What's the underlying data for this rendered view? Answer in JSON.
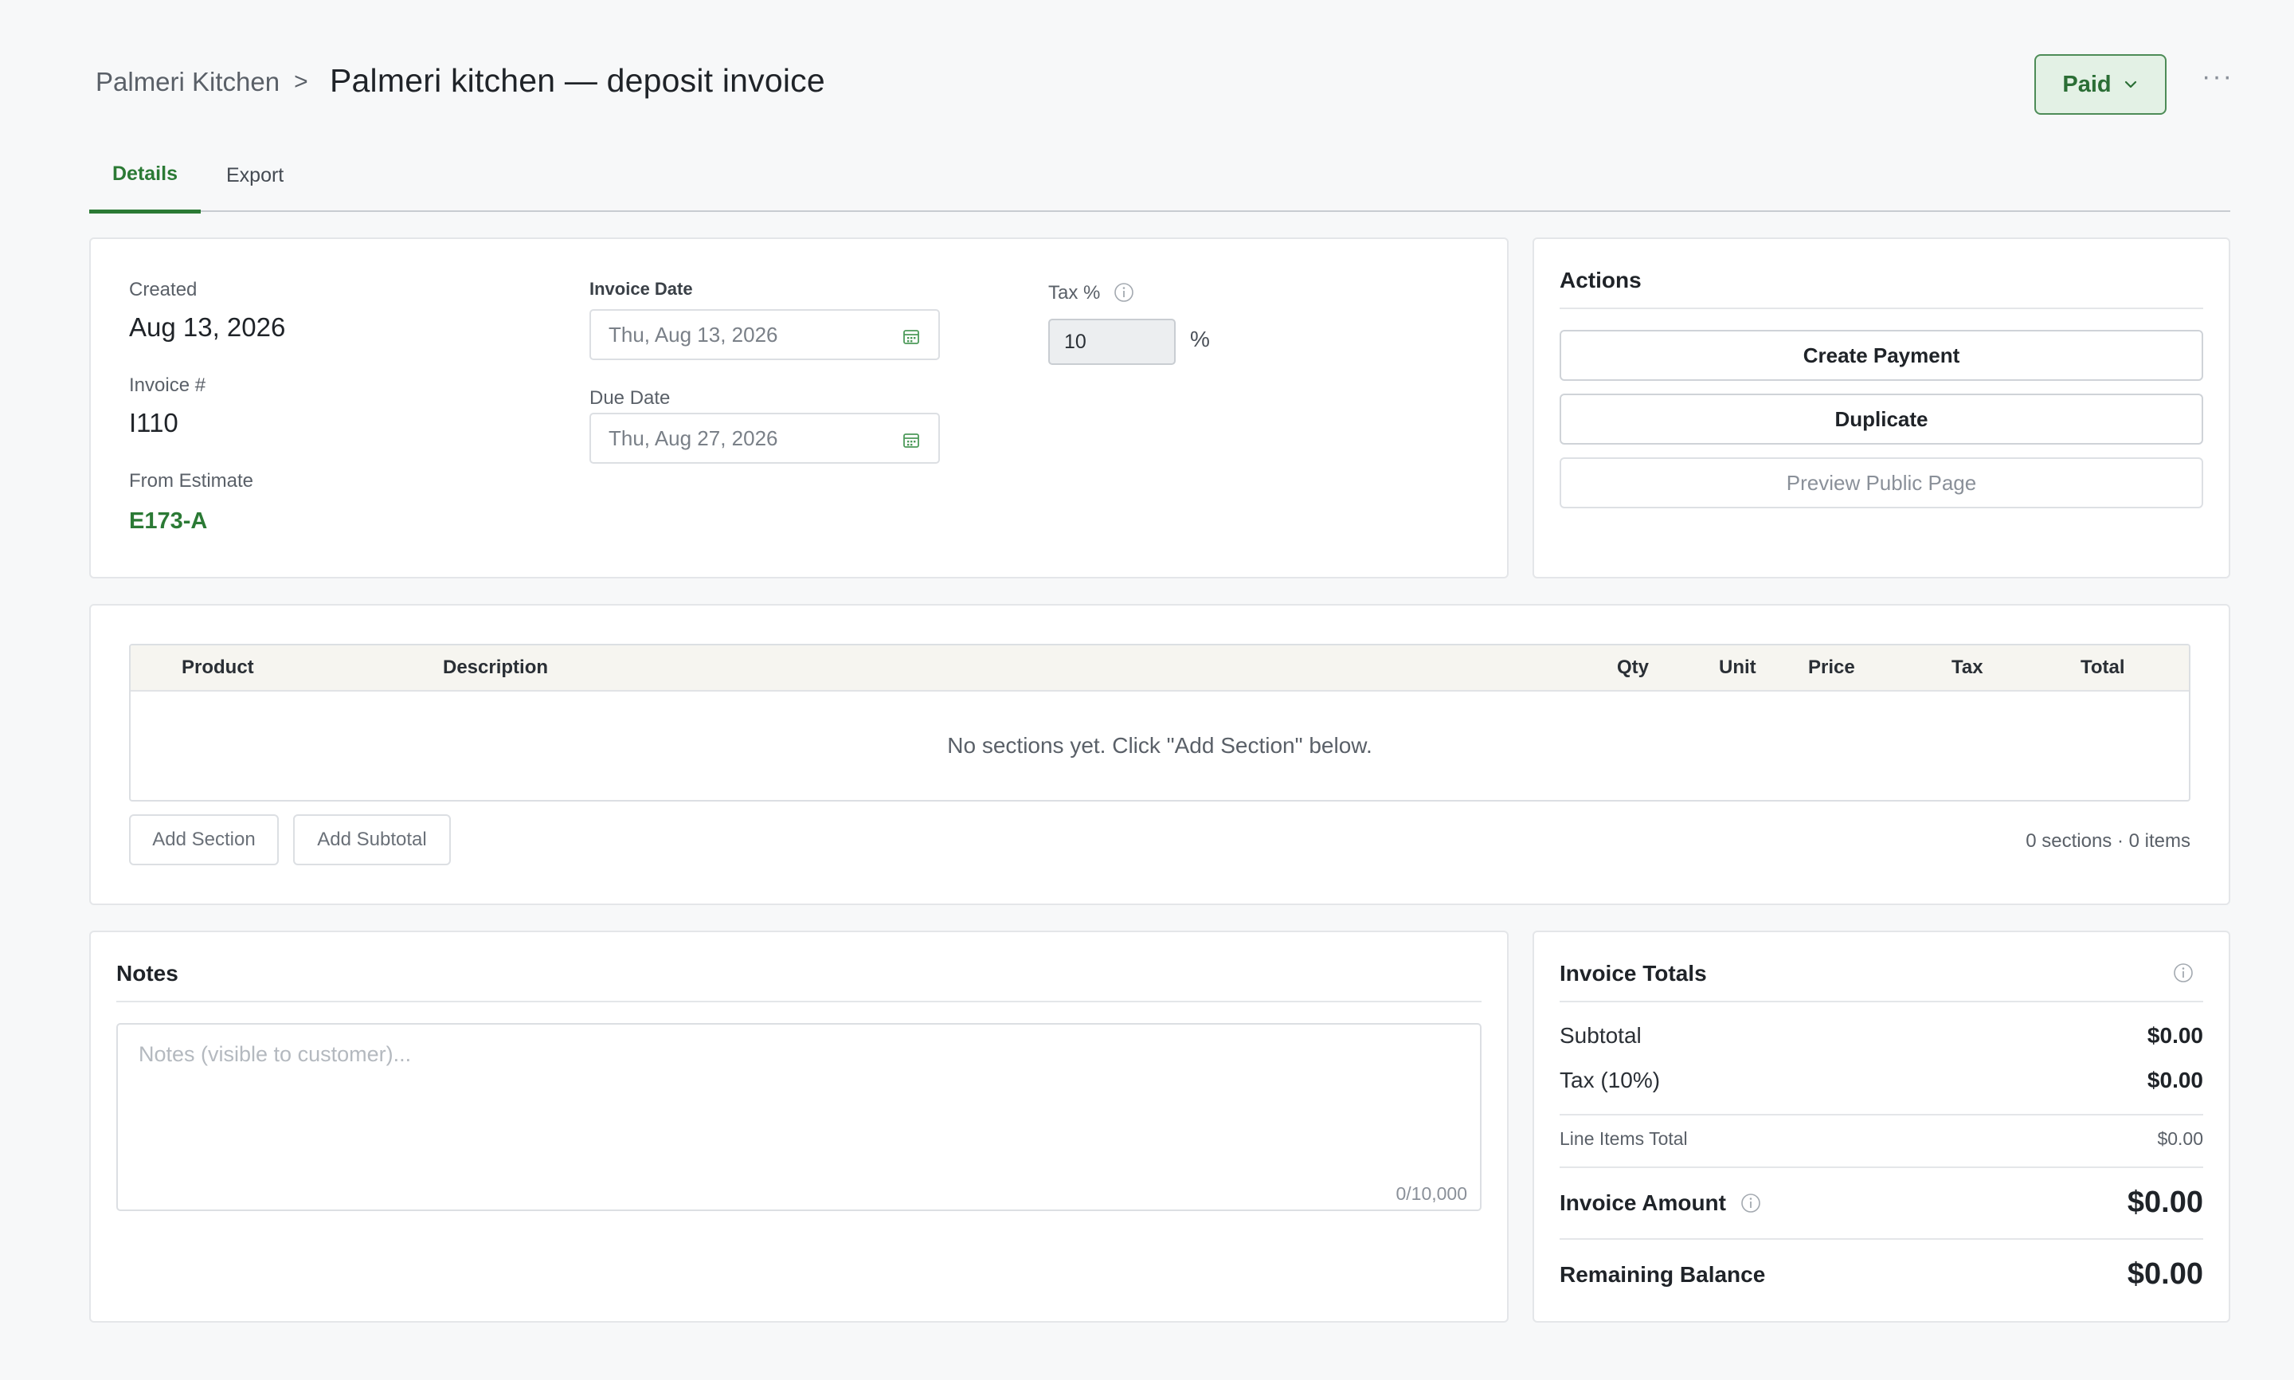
{
  "header": {
    "breadcrumb_parent": "Palmeri Kitchen",
    "breadcrumb_sep": ">",
    "title": "Palmeri kitchen — deposit invoice",
    "status_label": "Paid",
    "more_label": "···"
  },
  "tabs": [
    {
      "label": "Details",
      "active": true
    },
    {
      "label": "Export",
      "active": false
    }
  ],
  "details": {
    "created_label": "Created",
    "created_value": "Aug 13, 2026",
    "invoice_no_label": "Invoice #",
    "invoice_no_value": "I110",
    "from_estimate_label": "From Estimate",
    "from_estimate_value": "E173-A",
    "invoice_date_label": "Invoice Date",
    "invoice_date_value": "Thu, Aug 13, 2026",
    "due_date_label": "Due Date",
    "due_date_value": "Thu, Aug 27, 2026",
    "tax_label": "Tax %",
    "tax_value": "10",
    "tax_unit": "%"
  },
  "actions": {
    "title": "Actions",
    "create_payment": "Create Payment",
    "duplicate": "Duplicate",
    "preview": "Preview Public Page"
  },
  "line_items": {
    "columns": [
      "Product",
      "Description",
      "Qty",
      "Unit",
      "Price",
      "Tax",
      "Total"
    ],
    "empty_message": "No sections yet. Click \"Add Section\" below.",
    "add_section": "Add Section",
    "add_subtotal": "Add Subtotal",
    "counts": "0 sections · 0 items"
  },
  "notes": {
    "title": "Notes",
    "placeholder": "Notes (visible to customer)...",
    "counter": "0/10,000"
  },
  "totals": {
    "title": "Invoice Totals",
    "subtotal_label": "Subtotal",
    "subtotal_value": "$0.00",
    "tax_label": "Tax (10%)",
    "tax_value": "$0.00",
    "line_items_label": "Line Items Total",
    "line_items_value": "$0.00",
    "invoice_amount_label": "Invoice Amount",
    "invoice_amount_value": "$0.00",
    "remaining_label": "Remaining Balance",
    "remaining_value": "$0.00"
  },
  "colors": {
    "accent": "#2b7a35",
    "status_bg": "#e3f1e5",
    "table_header_bg": "#f6f5f0"
  }
}
